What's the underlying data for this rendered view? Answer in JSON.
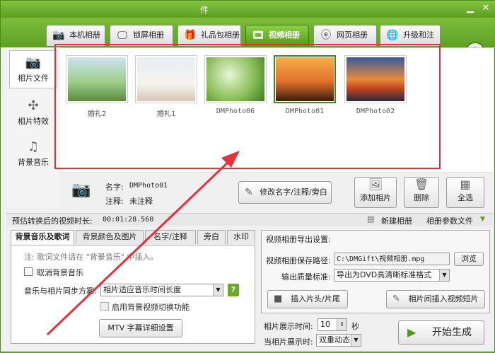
{
  "window": {
    "title_fragment": "件"
  },
  "tabs": [
    {
      "label": "本机相册",
      "icon": "camera-icon"
    },
    {
      "label": "锁屏相册",
      "icon": "monitor-icon"
    },
    {
      "label": "礼品包相册",
      "icon": "gift-icon"
    },
    {
      "label": "视频相册",
      "icon": "film-icon"
    },
    {
      "label": "网页相册",
      "icon": "browser-icon"
    },
    {
      "label": "升级和注册",
      "icon": "globe-icon"
    }
  ],
  "active_tab": "视频相册",
  "help_label": "?",
  "sidebar": {
    "items": [
      {
        "label": "相片文件",
        "icon": "camera-icon"
      },
      {
        "label": "相片特效",
        "icon": "effects-icon"
      },
      {
        "label": "背景音乐",
        "icon": "music-note-icon"
      }
    ]
  },
  "gallery": {
    "photos": [
      {
        "caption": "婚礼2"
      },
      {
        "caption": "婚礼1"
      },
      {
        "caption": "DMPhoto06"
      },
      {
        "caption": "DMPhoto01"
      },
      {
        "caption": "DMPhoto02"
      }
    ],
    "selected": "DMPhoto01"
  },
  "info": {
    "name_label": "名字:",
    "name_value": "DMPhoto01",
    "note_label": "注释:",
    "note_value": "未注释",
    "edit_button": "修改名字/注释/旁白",
    "add_button": "添加相片",
    "delete_button": "删除",
    "select_all_button": "全选"
  },
  "status": {
    "duration_label": "预估转换后的视频时长:",
    "duration_value": "00:01:28.560",
    "new_album": "新建相册",
    "album_params": "相册参数文件"
  },
  "left_panel": {
    "tabs": [
      "背景音乐及歌词",
      "背景颜色及图片",
      "名字/注释",
      "旁白",
      "水印"
    ],
    "note": "注: 歌词文件请在 \"背景音乐\" 中插入。",
    "cancel_bgm": "取消背景音乐",
    "sync_label": "音乐与相片同步方案:",
    "sync_value": "相片适应音乐时间长度",
    "bg_video_switch": "启用背景视频切换功能",
    "mtv_button": "MTV 字幕详细设置"
  },
  "right_panel": {
    "title": "视频相册导出设置:",
    "save_path_label": "视频相册保存路径:",
    "save_path_value": "C:\\DMGift\\视频相册.mpg",
    "browse": "浏览",
    "quality_label": "输出质量标准:",
    "quality_value": "导出为DVD高清晰标准格式",
    "insert_head": "插入片头/片尾",
    "insert_clip": "相片间插入视频短片",
    "show_time_label": "相片展示时间:",
    "show_time_value": "10",
    "seconds": "秒",
    "show_mode_label": "当相片展示时:",
    "show_mode_value": "双重动态",
    "start_button": "开始生成"
  },
  "colors": {
    "accent": "#5b9e22",
    "highlight": "#e8303a"
  }
}
